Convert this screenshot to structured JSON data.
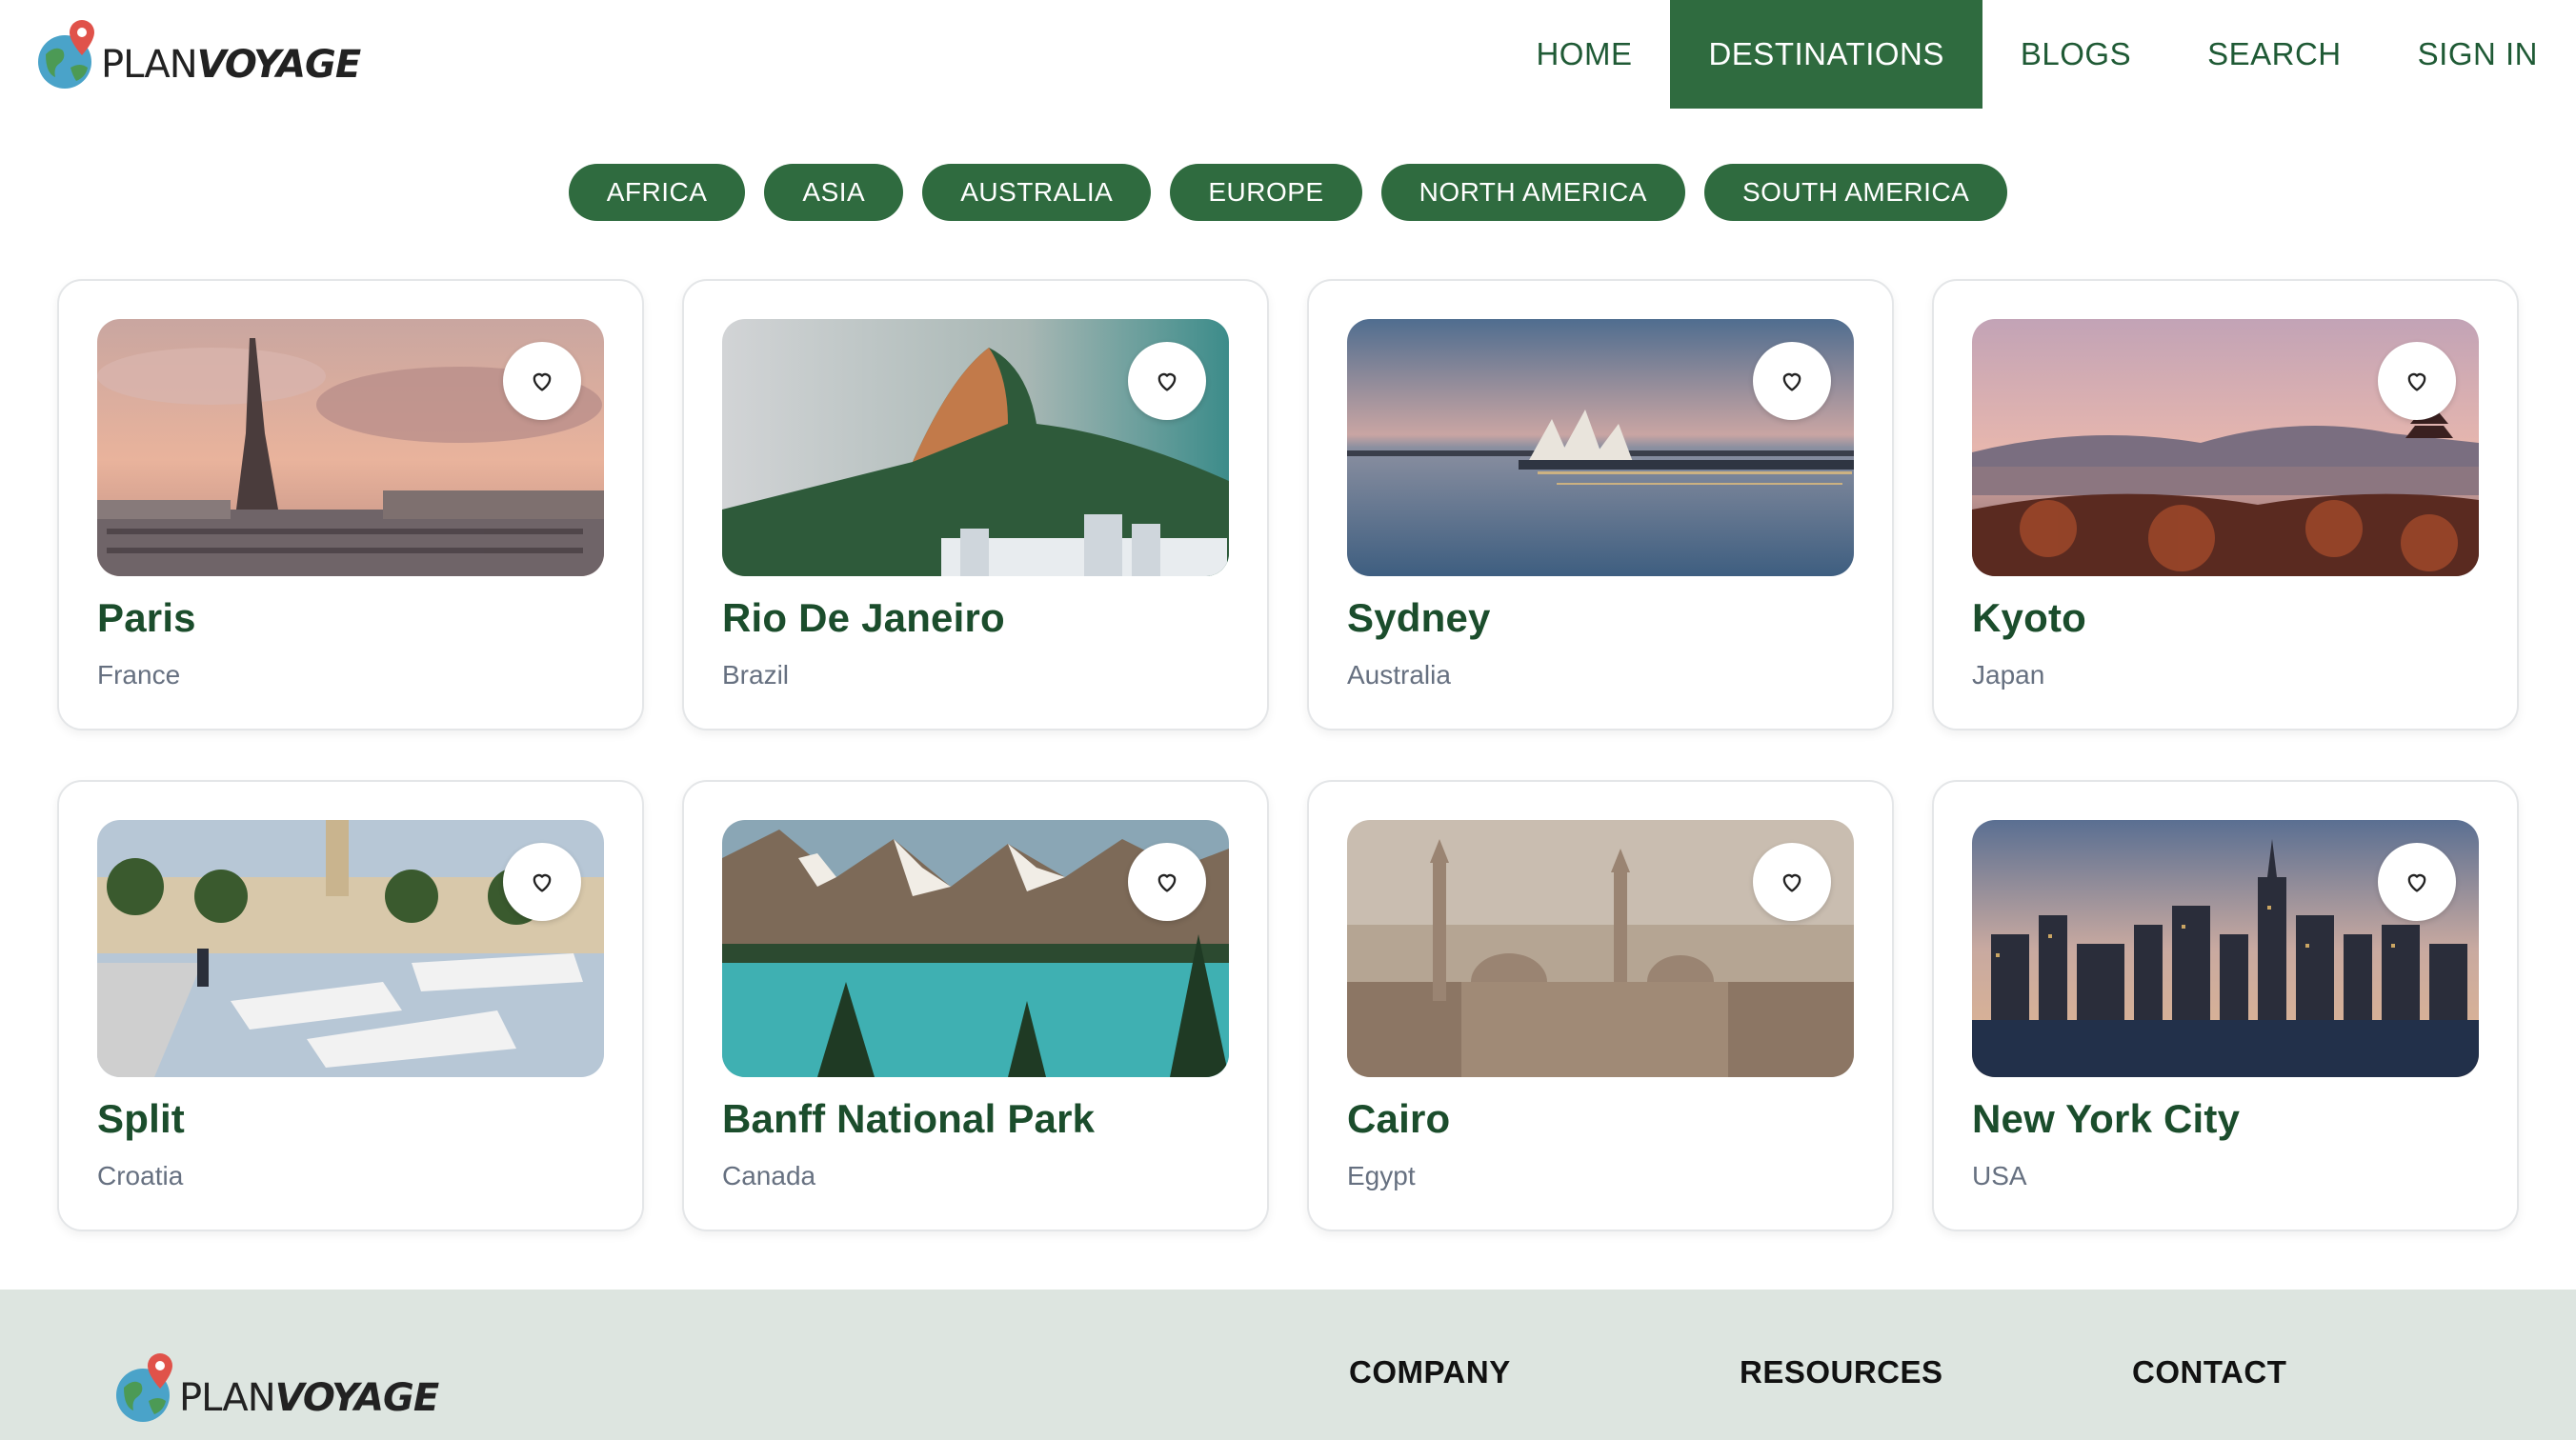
{
  "brand": {
    "name_plain": "PLAN",
    "name_bold": "VOYAGE",
    "accent": "#2f6b3f"
  },
  "nav": [
    {
      "label": "HOME",
      "active": false
    },
    {
      "label": "DESTINATIONS",
      "active": true
    },
    {
      "label": "BLOGS",
      "active": false
    },
    {
      "label": "SEARCH",
      "active": false
    },
    {
      "label": "SIGN IN",
      "active": false
    }
  ],
  "regions": [
    "AFRICA",
    "ASIA",
    "AUSTRALIA",
    "EUROPE",
    "NORTH AMERICA",
    "SOUTH AMERICA"
  ],
  "destinations": [
    {
      "name": "Paris",
      "country": "France",
      "icon": "heart-outline-icon"
    },
    {
      "name": "Rio De Janeiro",
      "country": "Brazil",
      "icon": "heart-outline-icon"
    },
    {
      "name": "Sydney",
      "country": "Australia",
      "icon": "heart-outline-icon"
    },
    {
      "name": "Kyoto",
      "country": "Japan",
      "icon": "heart-outline-icon"
    },
    {
      "name": "Split",
      "country": "Croatia",
      "icon": "heart-outline-icon"
    },
    {
      "name": "Banff National Park",
      "country": "Canada",
      "icon": "heart-outline-icon"
    },
    {
      "name": "Cairo",
      "country": "Egypt",
      "icon": "heart-outline-icon"
    },
    {
      "name": "New York City",
      "country": "USA",
      "icon": "heart-outline-icon"
    }
  ],
  "footer": {
    "columns": [
      "COMPANY",
      "RESOURCES",
      "CONTACT"
    ],
    "background": "#dde5e0"
  }
}
